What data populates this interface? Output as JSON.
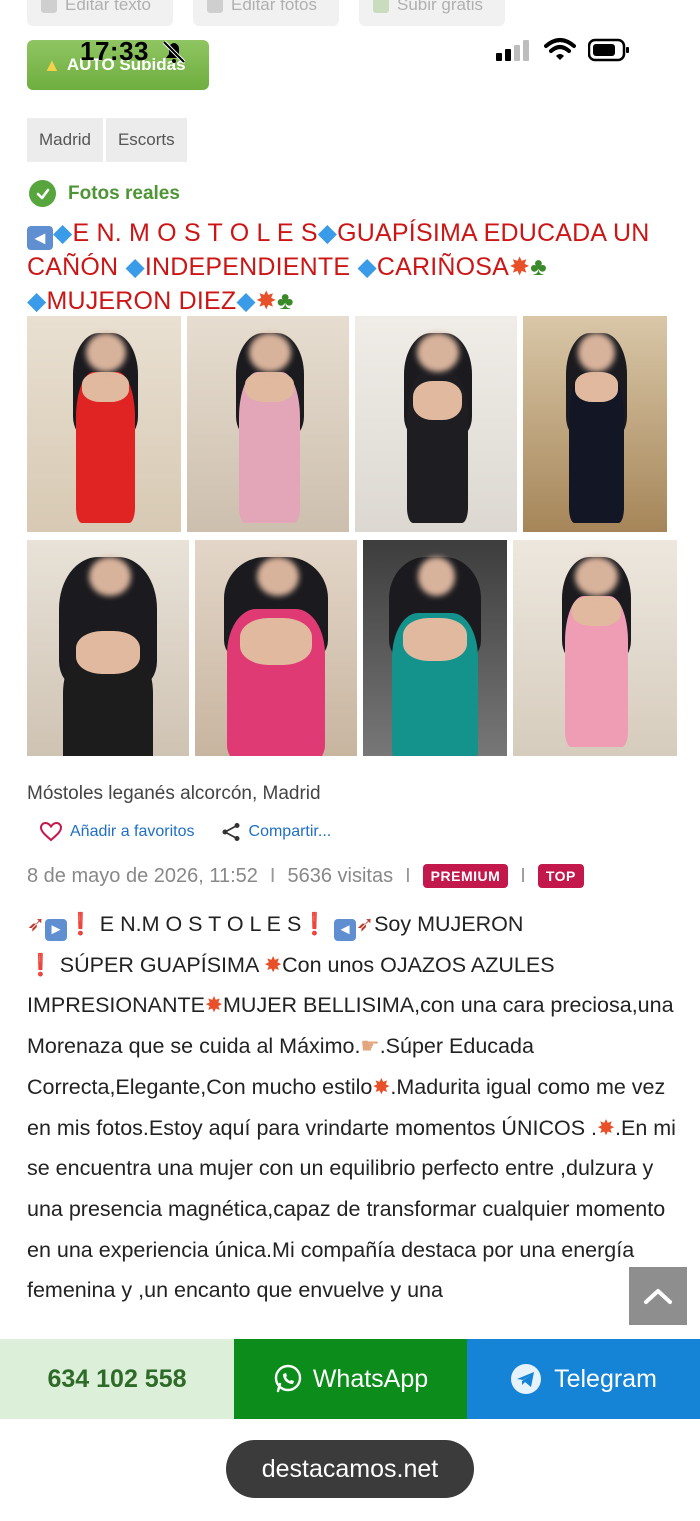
{
  "toolbar": {
    "edit_text": "Editar texto",
    "edit_photos": "Editar fotos",
    "upload_free": "Subir gratis"
  },
  "status": {
    "time": "17:33"
  },
  "auto_button": {
    "label": "AUTO Subidas"
  },
  "breadcrumb": [
    "Madrid",
    "Escorts"
  ],
  "verified_label": "Fotos reales",
  "title": {
    "p1": "E N. M O S T O L E S",
    "p2": "GUAPÍSIMA EDUCADA UN CAÑÓN ",
    "p3": "INDEPENDIENTE ",
    "p4": "CARIÑOSA",
    "p5": "MUJERON DIEZ"
  },
  "location": "Móstoles leganés alcorcón, Madrid",
  "actions": {
    "favorite": "Añadir a favoritos",
    "share": "Compartir..."
  },
  "meta": {
    "date": "8 de mayo de 2026, 11:52",
    "visits": "5636 visitas",
    "premium": "PREMIUM",
    "top": "TOP"
  },
  "description": {
    "a": "E N.M O S T O L E S",
    "b": "Soy MUJERON",
    "c": "SÚPER GUAPÍSIMA ",
    "d": "Con unos OJAZOS AZULES IMPRESIONANTE",
    "e": "MUJER BELLISIMA,con una cara preciosa,una Morenaza que se cuida al Máximo.",
    "f": ".Súper Educada Correcta,Elegante,Con mucho estilo",
    "g": ".Madurita igual como me vez en mis fotos.Estoy aquí para vrindarte momentos ÚNICOS .",
    "h": ".En mi se encuentra una mujer con un equilibrio perfecto entre ,dulzura y una presencia magnética,capaz de transformar cualquier momento en una experiencia única.Mi compañía destaca por una energía femenina y ,un encanto que envuelve y una"
  },
  "contact": {
    "phone": "634 102 558",
    "whatsapp": "WhatsApp",
    "telegram": "Telegram"
  },
  "site_url": "destacamos.net",
  "colors": {
    "title_red": "#cc1616",
    "verified_green": "#4e9536",
    "whatsapp_green": "#0c8c1b",
    "telegram_blue": "#1583d6",
    "badge": "#c2184b"
  }
}
